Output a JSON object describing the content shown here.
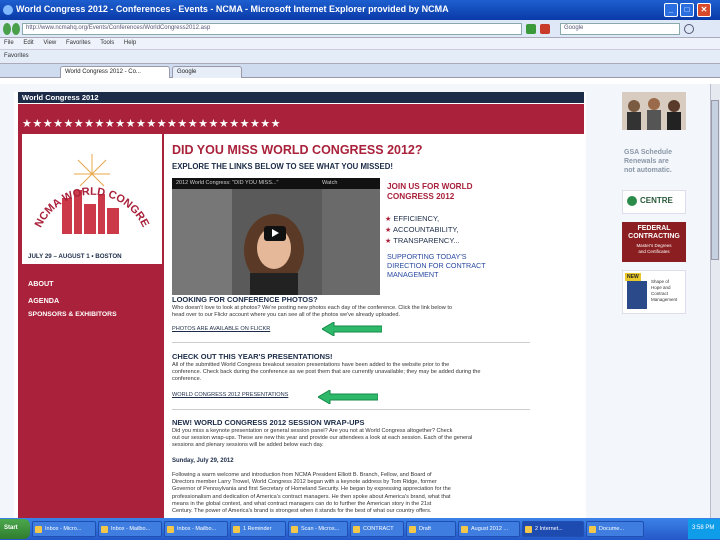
{
  "browser": {
    "title": "World Congress 2012 - Conferences - Events - NCMA - Microsoft Internet Explorer provided by NCMA",
    "url": "http://www.ncmahq.org/Events/Conferences/WorldCongress2012.asp",
    "search_placeholder": "Google",
    "menu": [
      "File",
      "Edit",
      "View",
      "Favorites",
      "Tools",
      "Help"
    ],
    "favorites_label": "Favorites",
    "tabs": [
      "World Congress 2012 - Co...",
      "Google"
    ]
  },
  "site": {
    "banner": "World Congress 2012",
    "logo_text": "NCMA WORLD CONGRESS 2012",
    "dates": "JULY 29 – AUGUST 1 • BOSTON",
    "nav": [
      "ABOUT",
      "AGENDA",
      "SPONSORS & EXHIBITORS"
    ]
  },
  "main": {
    "heading": "DID YOU MISS WORLD CONGRESS 2012?",
    "subheading": "EXPLORE THE LINKS BELOW TO SEE WHAT YOU MISSED!",
    "video_title": "2012 World Congress: \"DID YOU MISS...\"",
    "video_watch": "Watch",
    "join": [
      "JOIN US FOR WORLD",
      "CONGRESS 2012"
    ],
    "bullets": [
      "EFFICIENCY,",
      "ACCOUNTABILITY,",
      "TRANSPARENCY..."
    ],
    "supporting": [
      "SUPPORTING TODAY'S",
      "DIRECTION FOR CONTRACT",
      "MANAGEMENT"
    ],
    "photos_head": "LOOKING FOR CONFERENCE PHOTOS?",
    "photos_body": [
      "Who doesn't love to look at photos? We're posting new photos each day of the conference. Click the link below to",
      "head over to our Flickr account where you can see all of the photos we've already uploaded."
    ],
    "photos_link": "PHOTOS ARE AVAILABLE ON FLICKR",
    "pres_head": "CHECK OUT THIS YEAR'S PRESENTATIONS!",
    "pres_body": [
      "All of the submitted World Congress breakout session presentations have been added to the website prior to the",
      "conference. Check back during the conference as we post them that are currently unavailable; they may be added during the",
      "conference."
    ],
    "pres_link": "WORLD CONGRESS 2012 PRESENTATIONS",
    "wrap_head": "NEW! WORLD CONGRESS 2012 SESSION WRAP-UPS",
    "wrap_body": [
      "Did you miss a keynote presentation or general session panel? Are you not at World Congress altogether? Check",
      "out our session wrap-ups. These are new this year and provide our attendees a look at each session. Each of the general",
      "sessions and plenary sessions will be added below each day."
    ],
    "date": "Sunday, July 29, 2012",
    "sunday_body": [
      "Following a warm welcome and introduction from NCMA President Elliott B. Branch, Fellow, and Board of",
      "Directors member Larry Trowel, World Congress 2012 began with a keynote address by Tom Ridge, former",
      "Governor of Pennsylvania and first Secretary of Homeland Security. He began by expressing appreciation for the",
      "professionalism and dedication of America's contract managers. He then spoke about America's brand, what that",
      "means in the global context, and what contract managers can do to further the American story in the 21st",
      "Century. The power of America's brand is strongest when it stands for the best of what our country offers."
    ]
  },
  "sidebar": {
    "gsa": [
      "GSA Schedule",
      "Renewals are",
      "not automatic."
    ],
    "centre": "CENTRE",
    "fed": [
      "FEDERAL",
      "CONTRACTING"
    ],
    "fed_sub": [
      "Master's Degrees",
      "and Certificates"
    ],
    "new_label": "NEW",
    "book_label": [
      "Shape of",
      "Hope and",
      "Contract",
      "Management"
    ]
  },
  "taskbar": {
    "start": "Start",
    "items": [
      "Inbox - Micro...",
      "Inbox - Mailbo...",
      "Inbox - Mailbo...",
      "1 Reminder",
      "Scan - Micros...",
      "CONTRACT",
      "Draft",
      "August 2012 ...",
      "2 Internet...",
      "Docume..."
    ],
    "clock": "3:58 PM"
  },
  "colors": {
    "brand_red": "#a9213a",
    "brand_navy": "#1c2c48",
    "arrow_green": "#2db86a"
  }
}
